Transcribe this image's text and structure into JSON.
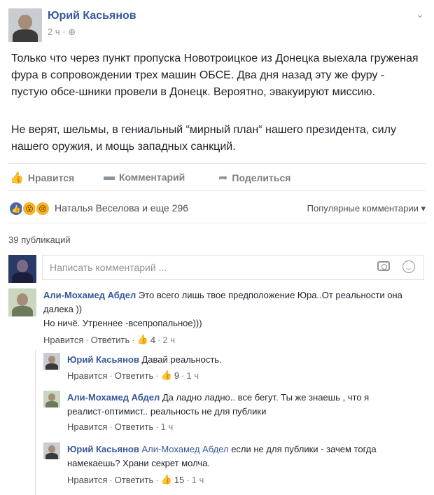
{
  "post": {
    "author": "Юрий Касьянов",
    "time": "2 ч",
    "paragraph1": "Только что через пункт пропуска Новотроицкое из Донецка выехала груженая фура в сопровождении трех машин ОБСЕ. Два дня назад эту же фуру - пустую обсе-шники провели в Донецк. Вероятно, эвакуируют миссию.",
    "paragraph2": "Не верят, шельмы, в гениальный “мирный план“ нашего президента, силу нашего оружия, и мощь западных санкций."
  },
  "actions": {
    "like": "Нравится",
    "comment": "Комментарий",
    "share": "Поделиться"
  },
  "reactions": {
    "text": "Наталья Веселова и еще 296",
    "sort_label": "Популярные комментарии"
  },
  "comments_count": "39 публикаций",
  "comment_input": {
    "placeholder": "Написать комментарий ..."
  },
  "comments": [
    {
      "author": "Али-Мохамед Абдел",
      "text": "Это всего лишь твое предположение Юра..От реальности она далека ))",
      "text2": "Но ничё. Утреннее -всепропальное)))",
      "like": "Нравится",
      "reply": "Ответить",
      "likes": "4",
      "time": "2 ч"
    },
    {
      "author": "Юрий Касьянов",
      "text": "Давай реальность.",
      "like": "Нравится",
      "reply": "Ответить",
      "likes": "9",
      "time": "1 ч"
    },
    {
      "author": "Али-Мохамед Абдел",
      "text": "Да ладно ладно.. все бегут. Ты же знаешь , что я реалист-оптимист.. реальность не для публики",
      "like": "Нравится",
      "reply": "Ответить",
      "time": "1 ч"
    },
    {
      "author": "Юрий Касьянов",
      "mention": "Али-Мохамед Абдел",
      "text": "если не для публики - зачем тогда намекаешь? Храни секрет молча.",
      "like": "Нравится",
      "reply": "Ответить",
      "likes": "15",
      "time": "1 ч"
    }
  ],
  "colors": {
    "link": "#365899",
    "like_blue": "#4267b2",
    "secondary": "#90949c"
  },
  "icons": [
    "chevron-down-icon",
    "globe-icon",
    "like-icon",
    "comment-icon",
    "share-icon",
    "camera-icon",
    "smiley-icon",
    "thumbs-up-icon"
  ]
}
